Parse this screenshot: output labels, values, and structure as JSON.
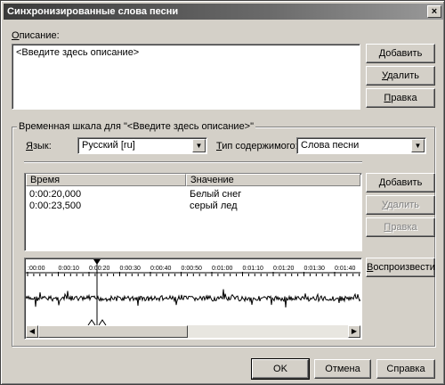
{
  "window": {
    "title": "Синхронизированные слова песни",
    "close_glyph": "×"
  },
  "description": {
    "label": "Описание:",
    "items": [
      "<Введите здесь описание>"
    ],
    "buttons": {
      "add": "Добавить",
      "remove": "Удалить",
      "edit": "Правка"
    }
  },
  "timeline": {
    "group_label": "Временная шкала для \"<Введите здесь описание>\"",
    "language_label": "Язык:",
    "language_value": "Русский [ru]",
    "content_type_label": "Тип содержимого:",
    "content_type_value": "Слова песни",
    "columns": [
      "Время",
      "Значение"
    ],
    "rows": [
      {
        "time": "0:00:20,000",
        "value": "Белый снег"
      },
      {
        "time": "0:00:23,500",
        "value": "серый лед"
      }
    ],
    "buttons": {
      "add": "Добавить",
      "remove": "Удалить",
      "edit": "Правка",
      "play": "Воспроизвести"
    },
    "ruler_labels": [
      ":00:00",
      "0:00:10",
      "0:00:20",
      "0:00:30",
      "0:00:40",
      "0:00:50",
      "0:01:00",
      "0:01:10",
      "0:01:20",
      "0:01:30",
      "0:01:40"
    ]
  },
  "footer": {
    "ok": "OK",
    "cancel": "Отмена",
    "help": "Справка"
  }
}
